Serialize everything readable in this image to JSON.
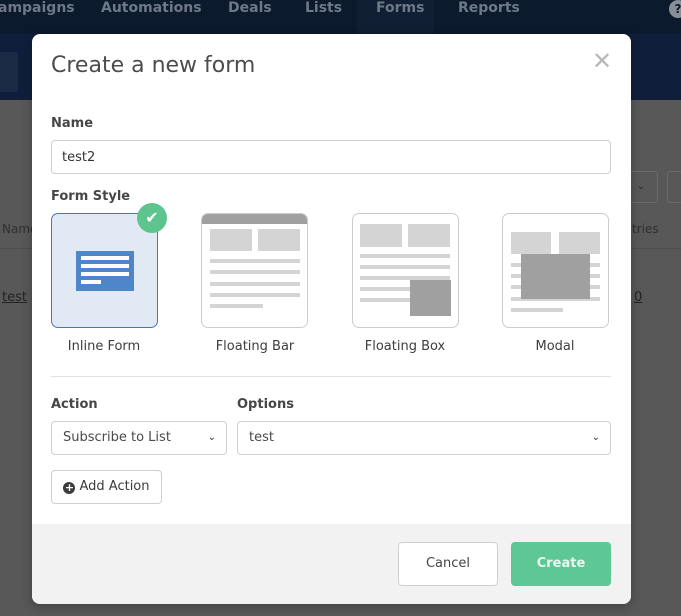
{
  "background": {
    "nav": [
      {
        "label": "ampaigns",
        "active": false
      },
      {
        "label": "Automations",
        "active": false
      },
      {
        "label": "Deals",
        "active": false
      },
      {
        "label": "Lists",
        "active": false
      },
      {
        "label": "Forms",
        "active": true
      },
      {
        "label": "Reports",
        "active": false
      }
    ],
    "help_glyph": "?",
    "table": {
      "col_name": "Name",
      "col_entries": "tries",
      "row_name": "test",
      "row_entries": "0"
    },
    "select_chevron": "⌄"
  },
  "modal": {
    "title": "Create a new form",
    "close_glyph": "✕",
    "name_label": "Name",
    "name_value": "test2",
    "form_style_label": "Form Style",
    "styles": [
      {
        "label": "Inline Form",
        "selected": true
      },
      {
        "label": "Floating Bar",
        "selected": false
      },
      {
        "label": "Floating Box",
        "selected": false
      },
      {
        "label": "Modal",
        "selected": false
      }
    ],
    "check_glyph": "✔",
    "action_label": "Action",
    "action_value": "Subscribe to List",
    "options_label": "Options",
    "options_value": "test",
    "chevron_glyph": "⌄",
    "add_action_label": "Add Action",
    "plus_glyph": "+",
    "cancel_label": "Cancel",
    "create_label": "Create"
  },
  "colors": {
    "accent_green": "#5dc895",
    "selected_blue": "#4a77b4",
    "nav_bg": "#0c1a2e"
  }
}
